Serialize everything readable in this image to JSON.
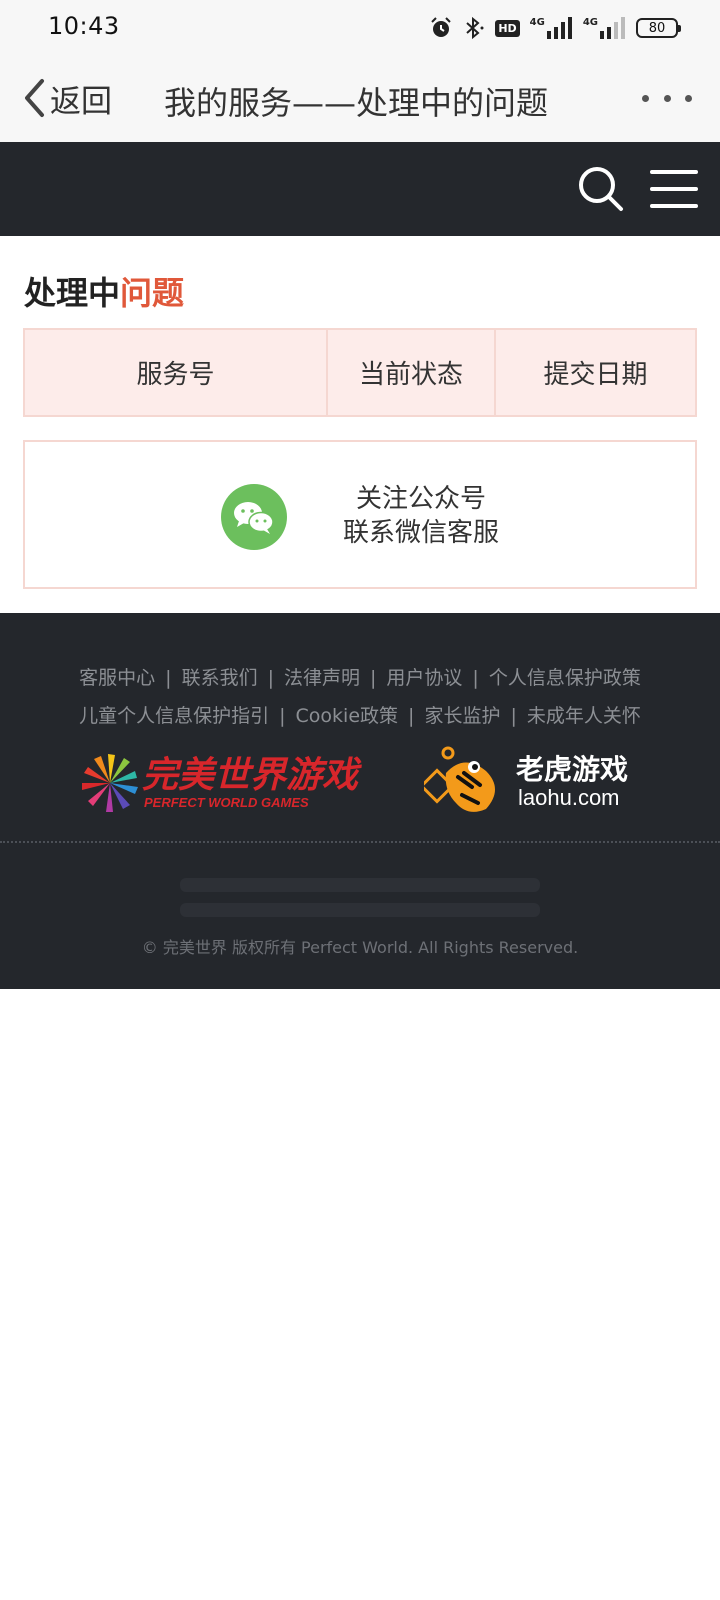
{
  "status_bar": {
    "time": "10:43",
    "hd_label": "HD",
    "signal_1": "4G",
    "signal_2": "4G",
    "battery": "80"
  },
  "nav": {
    "back_label": "返回",
    "title": "我的服务——处理中的问题"
  },
  "header": {
    "search_icon": "search-icon",
    "menu_icon": "hamburger-menu-icon"
  },
  "main": {
    "section_title_prefix": "处理中",
    "section_title_accent": "问题",
    "table_headers": [
      "服务号",
      "当前状态",
      "提交日期"
    ],
    "wechat": {
      "line1": "关注公众号",
      "line2": "联系微信客服"
    }
  },
  "footer": {
    "links_row1": [
      "客服中心",
      "联系我们",
      "法律声明",
      "用户协议",
      "个人信息保护政策"
    ],
    "links_row2": [
      "儿童个人信息保护指引",
      "Cookie政策",
      "家长监护",
      "未成年人关怀"
    ],
    "logo_pw_cn": "完美世界游戏",
    "logo_pw_en": "PERFECT  WORLD  GAMES",
    "logo_laohu_cn": "老虎游戏",
    "logo_laohu_en": "laohu.com",
    "copyright": "© 完美世界 版权所有    Perfect World. All Rights Reserved."
  },
  "colors": {
    "accent": "#e0583a",
    "header_bg": "#24272c",
    "table_head_bg": "#fdecea",
    "wechat_green": "#6cbf5d"
  }
}
